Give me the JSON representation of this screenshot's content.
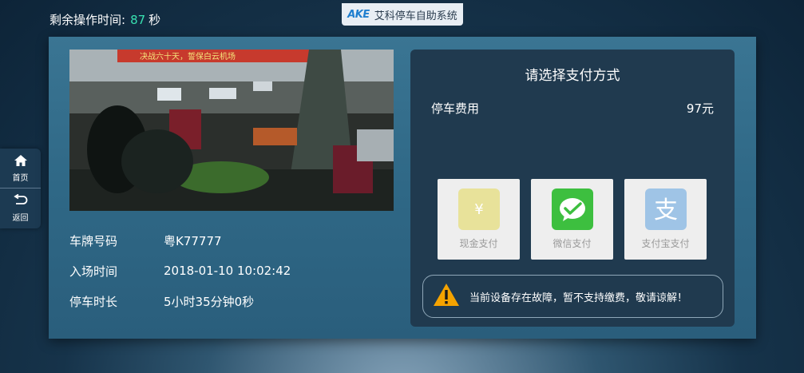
{
  "header": {
    "timer_label": "剩余操作时间:",
    "timer_count": "87",
    "timer_unit": "秒",
    "brand_logo": "AKE",
    "brand_name": "艾科停车自助系统"
  },
  "sidenav": {
    "home_label": "首页",
    "back_label": "返回"
  },
  "photo": {
    "banner_text": "决战六十天，誓保白云机场"
  },
  "vehicle": {
    "plate_label": "车牌号码",
    "plate_value": "粤K77777",
    "entry_label": "入场时间",
    "entry_value": "2018-01-10 10:02:42",
    "duration_label": "停车时长",
    "duration_value": "5小时35分钟0秒"
  },
  "payment": {
    "title": "请选择支付方式",
    "fee_label": "停车费用",
    "fee_value": "97元",
    "methods": [
      {
        "label": "现金支付",
        "icon": "cash-icon",
        "color": "#e8e29a"
      },
      {
        "label": "微信支付",
        "icon": "wechat-icon",
        "color": "#3dbf3f"
      },
      {
        "label": "支付宝支付",
        "icon": "alipay-icon",
        "color": "#9fc4e6"
      }
    ],
    "notice": "当前设备存在故障，暂不支持缴费，敬请谅解！"
  },
  "colors": {
    "accent": "#38e0b0",
    "card": "#2f6886",
    "pay_panel": "#203a4f",
    "warning": "#f5a300"
  }
}
